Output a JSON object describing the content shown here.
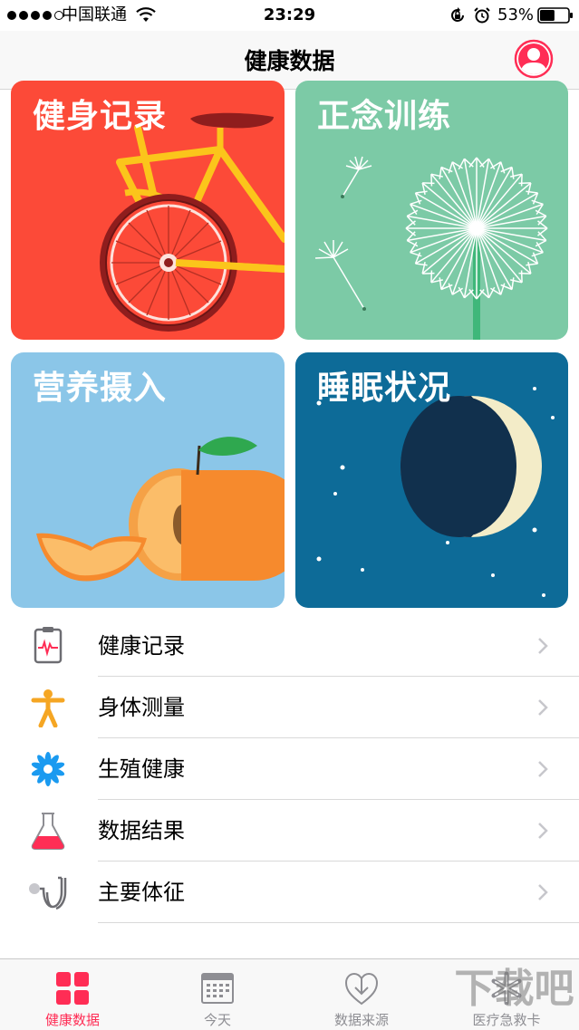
{
  "status_bar": {
    "carrier": "中国联通",
    "time": "23:29",
    "battery": "53%",
    "battery_level": 0.53,
    "signal_bars_filled": 4,
    "signal_bars_total": 5
  },
  "nav": {
    "title": "健康数据"
  },
  "tiles": [
    {
      "title": "健身记录",
      "color": "#fc4a38"
    },
    {
      "title": "正念训练",
      "color": "#7ccaa6"
    },
    {
      "title": "营养摄入",
      "color": "#8bc6e8"
    },
    {
      "title": "睡眠状况",
      "color": "#0d6b98"
    }
  ],
  "list": [
    {
      "label": "健康记录",
      "icon": "health-records-icon"
    },
    {
      "label": "身体测量",
      "icon": "body-measurements-icon"
    },
    {
      "label": "生殖健康",
      "icon": "reproductive-health-icon"
    },
    {
      "label": "数据结果",
      "icon": "lab-results-icon"
    },
    {
      "label": "主要体征",
      "icon": "vitals-stethoscope-icon"
    }
  ],
  "tabs": [
    {
      "label": "健康数据",
      "icon": "health-data-grid-icon",
      "active": true
    },
    {
      "label": "今天",
      "icon": "calendar-icon",
      "active": false
    },
    {
      "label": "数据来源",
      "icon": "download-heart-icon",
      "active": false
    },
    {
      "label": "医疗急救卡",
      "icon": "medical-id-icon",
      "active": false
    }
  ],
  "watermark": "下载吧",
  "colors": {
    "accent": "#ff2d55",
    "tab_inactive": "#8e8e93"
  }
}
